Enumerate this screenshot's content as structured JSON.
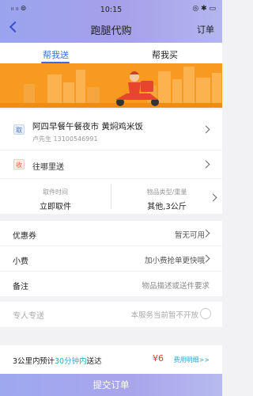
{
  "status_bar": {
    "signal": "ᵢₗ ᵢₗ ⊚",
    "time": "10:15",
    "battery": "◎ ✱ ▭"
  },
  "header": {
    "title": "跑腿代购",
    "orders_label": "订单"
  },
  "tabs": [
    {
      "label": "帮我送",
      "active": true
    },
    {
      "label": "帮我买",
      "active": false
    }
  ],
  "pickup": {
    "badge": "取",
    "name": "阿四早餐午餐夜市 黄焖鸡米饭",
    "contact": "卢先生  13100546991"
  },
  "dropoff": {
    "badge": "收",
    "placeholder": "往哪里送"
  },
  "pick_time": {
    "label": "取件时间",
    "value": "立即取件"
  },
  "item_type": {
    "label": "物品类型/重量",
    "value": "其他,3公斤"
  },
  "coupon": {
    "label": "优惠券",
    "value": "暂无可用"
  },
  "tip": {
    "label": "小费",
    "value": "加小费抢单更快哦"
  },
  "note": {
    "label": "备注",
    "value": "物品描述或送件要求"
  },
  "special": {
    "label": "专人专送",
    "value": "本服务当前暂不开放",
    "enabled": false
  },
  "footer": {
    "distance": "3公里内",
    "eta_prefix": "预计",
    "eta_minutes": "30分钟内",
    "eta_suffix": "送达",
    "price": "¥6",
    "detail_link": "费用明细>>"
  },
  "submit_label": "提交订单",
  "colors": {
    "accent": "#3b6fd8",
    "banner": "#f79a1f",
    "header": "#a7a0ea",
    "price": "#e23c2a"
  }
}
